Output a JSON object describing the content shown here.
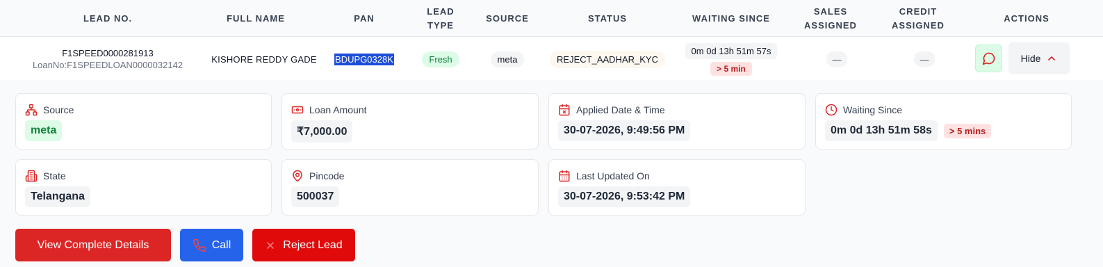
{
  "table": {
    "headers": [
      {
        "line1": "LEAD NO.",
        "line2": ""
      },
      {
        "line1": "FULL NAME",
        "line2": ""
      },
      {
        "line1": "PAN",
        "line2": ""
      },
      {
        "line1": "LEAD",
        "line2": "TYPE"
      },
      {
        "line1": "SOURCE",
        "line2": ""
      },
      {
        "line1": "STATUS",
        "line2": ""
      },
      {
        "line1": "WAITING SINCE",
        "line2": ""
      },
      {
        "line1": "SALES",
        "line2": "ASSIGNED"
      },
      {
        "line1": "CREDIT",
        "line2": "ASSIGNED"
      },
      {
        "line1": "ACTIONS",
        "line2": ""
      }
    ],
    "row": {
      "lead_no": "F1SPEED0000281913",
      "loan_no": "LoanNo:F1SPEEDLOAN0000032142",
      "full_name": "KISHORE REDDY GADE",
      "pan": "BDUPG0328K",
      "lead_type": "Fresh",
      "source": "meta",
      "status": "REJECT_AADHAR_KYC",
      "waiting_time": "0m 0d 13h 51m 57s",
      "waiting_badge": "> 5 min",
      "sales_assigned": "—",
      "credit_assigned": "—",
      "hide_label": "Hide"
    }
  },
  "details": {
    "source": {
      "label": "Source",
      "value": "meta"
    },
    "loan_amount": {
      "label": "Loan Amount",
      "value": "₹7,000.00"
    },
    "applied": {
      "label": "Applied Date & Time",
      "value": "30-07-2026, 9:49:56 PM"
    },
    "waiting": {
      "label": "Waiting Since",
      "value": "0m 0d 13h 51m 58s",
      "badge": "> 5 mins"
    },
    "state": {
      "label": "State",
      "value": "Telangana"
    },
    "pincode": {
      "label": "Pincode",
      "value": "500037"
    },
    "updated": {
      "label": "Last Updated On",
      "value": "30-07-2026, 9:53:42 PM"
    }
  },
  "actions": {
    "view": "View Complete Details",
    "call": "Call",
    "reject": "Reject Lead"
  },
  "colors": {
    "accent_red": "#dc2626",
    "call_blue": "#2563eb",
    "badge_green": "#15803d"
  }
}
